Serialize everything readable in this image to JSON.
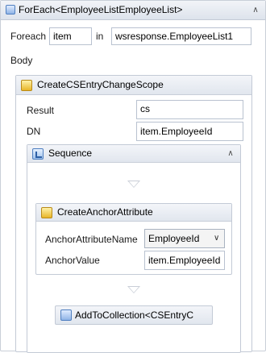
{
  "foreach": {
    "title": "ForEach<EmployeeListEmployeeList>",
    "foreach_label": "Foreach",
    "item_value": "item",
    "in_label": "in",
    "collection_value": "wsresponse.EmployeeList1",
    "body_label": "Body"
  },
  "scope": {
    "title": "CreateCSEntryChangeScope",
    "result_label": "Result",
    "result_value": "cs",
    "dn_label": "DN",
    "dn_value": "item.EmployeeId"
  },
  "sequence": {
    "title": "Sequence"
  },
  "anchor": {
    "title": "CreateAnchorAttribute",
    "name_label": "AnchorAttributeName",
    "name_value": "EmployeeId",
    "value_label": "AnchorValue",
    "value_value": "item.EmployeeId"
  },
  "add_collection": {
    "title": "AddToCollection<CSEntryC"
  },
  "icons": {
    "collapse": "double-chevron-up-icon",
    "scope": "scope-activity-icon",
    "sequence": "sequence-activity-icon",
    "add": "add-to-collection-icon",
    "dropdown": "chevron-down-icon"
  }
}
